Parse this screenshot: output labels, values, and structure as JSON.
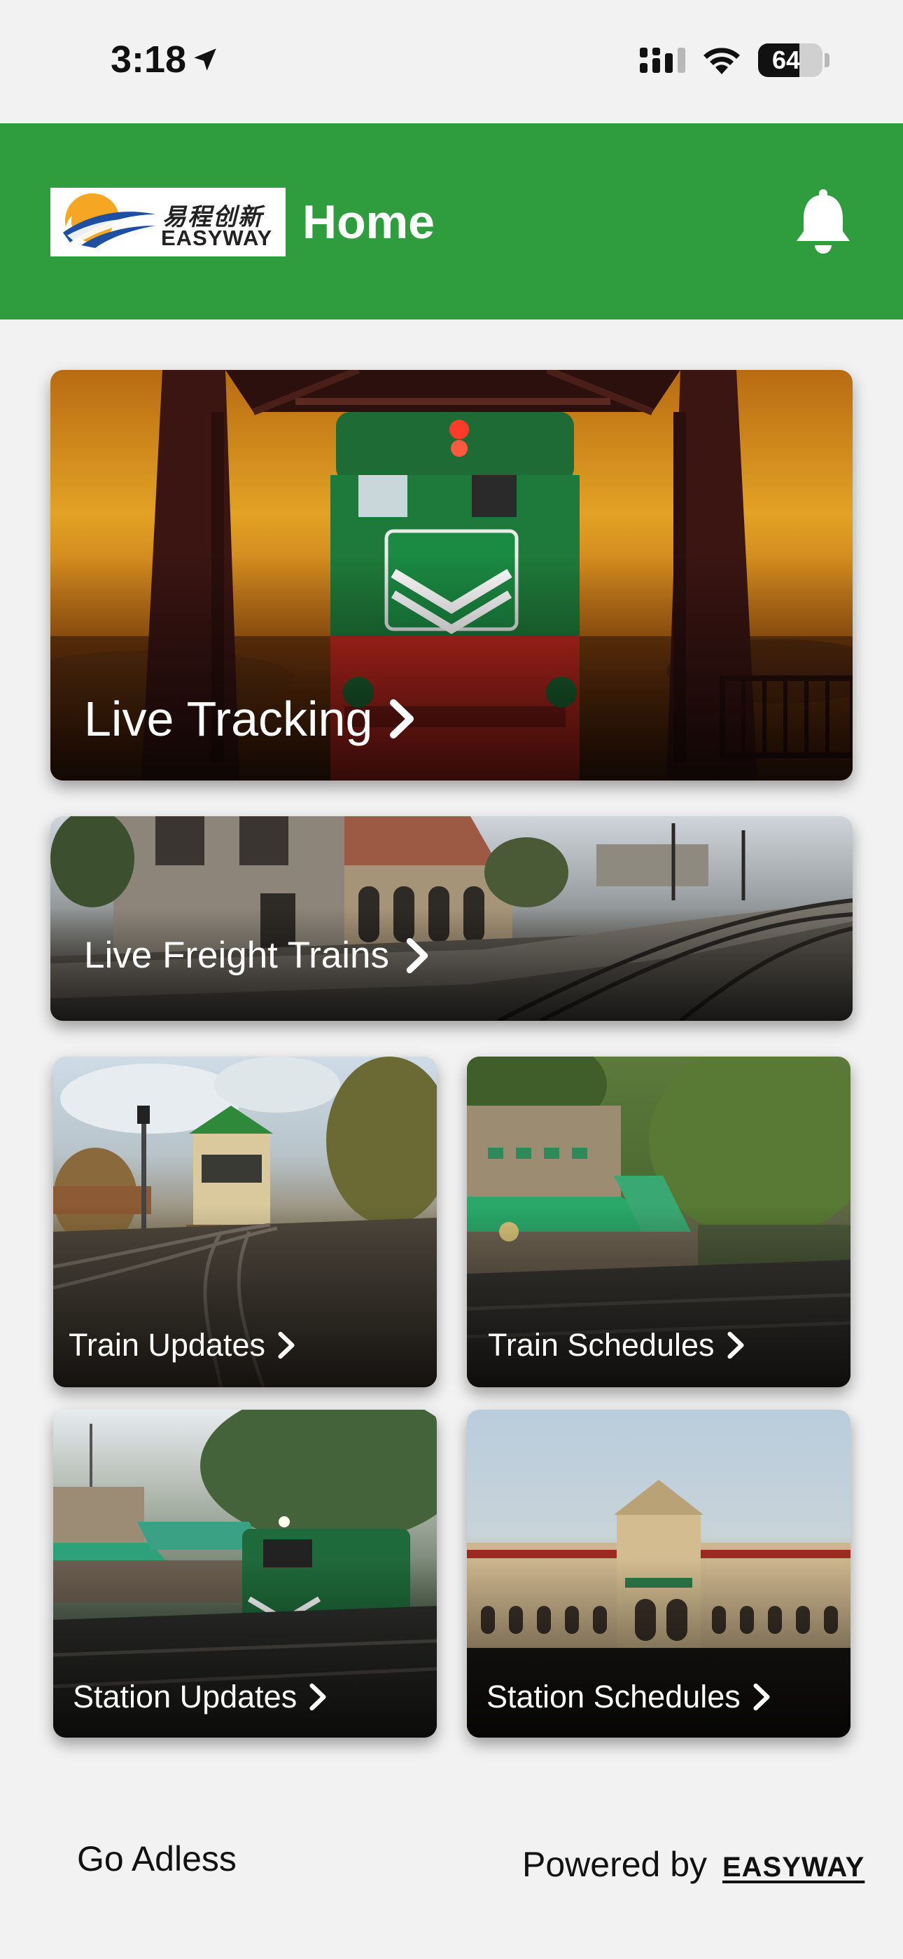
{
  "status_bar": {
    "time": "3:18",
    "battery": "64",
    "battery_level": 0.64
  },
  "header": {
    "logo_chinese": "易程创新",
    "logo_english": "EASYWAY",
    "title": "Home",
    "bell_icon": "bell-icon"
  },
  "cards": {
    "live_tracking": "Live Tracking",
    "live_freight": "Live Freight Trains",
    "train_updates": "Train Updates",
    "train_schedules": "Train Schedules",
    "station_updates": "Station Updates",
    "station_schedules": "Station Schedules"
  },
  "footer": {
    "left": "Go Adless",
    "powered_by": "Powered by",
    "brand": "EASYWAY"
  },
  "colors": {
    "header_green": "#2f9c3e",
    "background": "#f2f2f2",
    "logo_yellow": "#f5a623",
    "logo_blue": "#1e4fa0"
  }
}
